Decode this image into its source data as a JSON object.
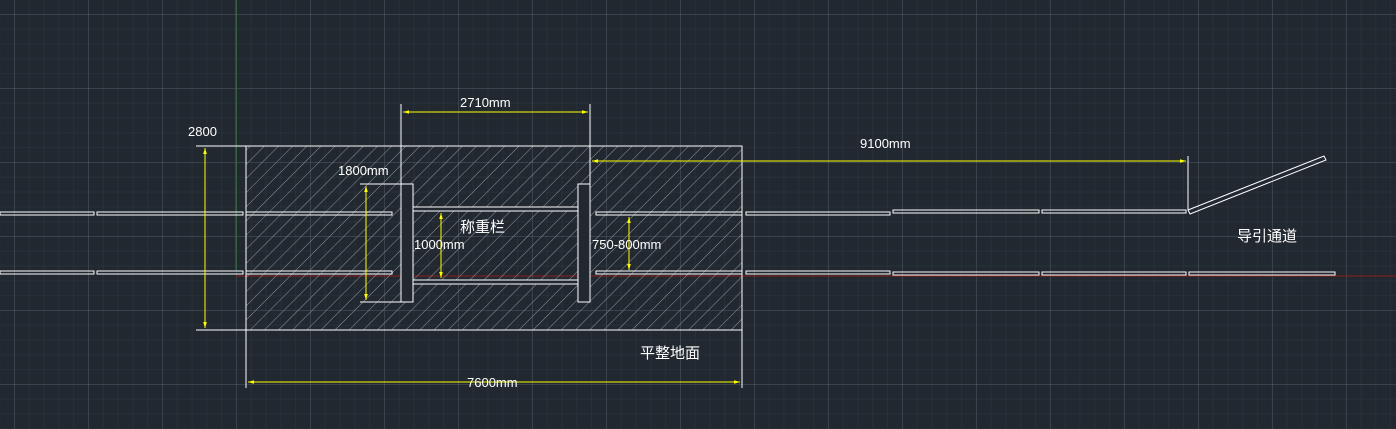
{
  "labels": {
    "height_total": "2800",
    "width_total": "7600mm",
    "scale_length": "2710mm",
    "scale_height": "1800mm",
    "inner_width": "1000mm",
    "lane_width": "750-800mm",
    "lead_length": "9100mm",
    "scale_rail": "称重栏",
    "lead_channel": "导引通道",
    "ground": "平整地面"
  },
  "colors": {
    "background": "#212830",
    "line": "#ffffff",
    "dimension": "#ffff00",
    "hatch": "#9aa0a6",
    "axis_green": "#2e7d32",
    "axis_red": "#8b1e1e"
  }
}
